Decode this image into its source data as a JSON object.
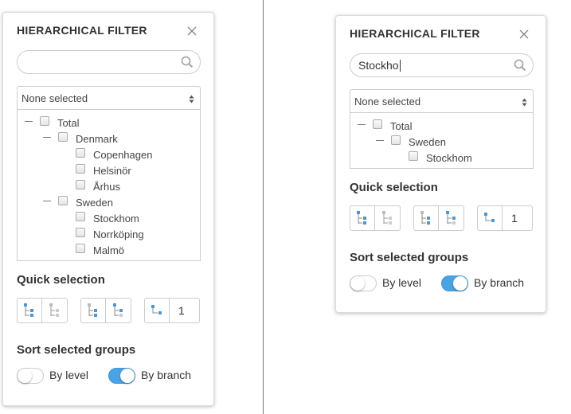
{
  "colors": {
    "toggle_on": "#4ba3e3",
    "icon_blue": "#4b97d4",
    "text": "#333333",
    "border": "#cccccc"
  },
  "left_panel": {
    "title": "HIERARCHICAL FILTER",
    "search": {
      "value": "",
      "placeholder": ""
    },
    "select": {
      "value": "None selected"
    },
    "tree": [
      {
        "label": "Total",
        "level": 0,
        "expanded": true
      },
      {
        "label": "Denmark",
        "level": 1,
        "expanded": true
      },
      {
        "label": "Copenhagen",
        "level": 2
      },
      {
        "label": "Helsinör",
        "level": 2
      },
      {
        "label": "Århus",
        "level": 2
      },
      {
        "label": "Sweden",
        "level": 1,
        "expanded": true
      },
      {
        "label": "Stockhom",
        "level": 2
      },
      {
        "label": "Norrköping",
        "level": 2
      },
      {
        "label": "Malmö",
        "level": 2
      }
    ],
    "quick_selection": {
      "title": "Quick selection",
      "level_value": "1"
    },
    "sort": {
      "title": "Sort selected groups",
      "by_level": "By level",
      "by_branch": "By branch",
      "active": "by_branch"
    }
  },
  "right_panel": {
    "title": "HIERARCHICAL FILTER",
    "search": {
      "value": "Stockho"
    },
    "select": {
      "value": "None selected"
    },
    "tree": [
      {
        "label": "Total",
        "level": 0,
        "expanded": true
      },
      {
        "label": "Sweden",
        "level": 1,
        "expanded": true
      },
      {
        "label": "Stockhom",
        "level": 2
      }
    ],
    "quick_selection": {
      "title": "Quick selection",
      "level_value": "1"
    },
    "sort": {
      "title": "Sort selected groups",
      "by_level": "By level",
      "by_branch": "By branch",
      "active": "by_branch"
    }
  }
}
